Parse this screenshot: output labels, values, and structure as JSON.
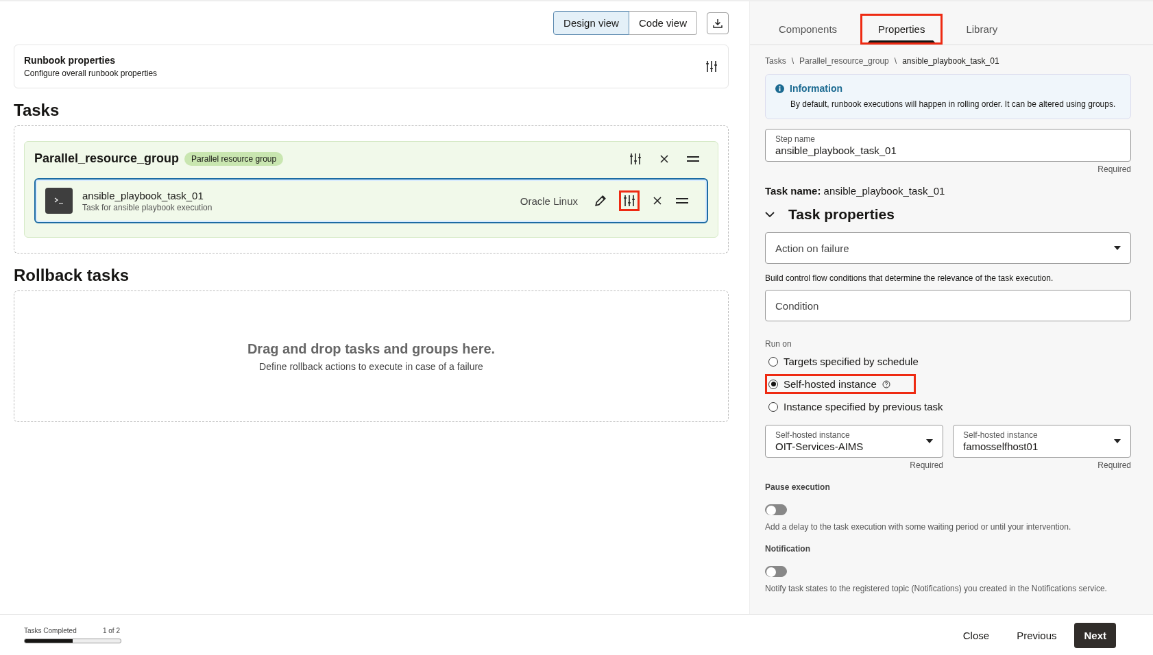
{
  "view_switch": [
    {
      "label": "Design view",
      "selected": true
    },
    {
      "label": "Code view",
      "selected": false
    }
  ],
  "runbook_properties": {
    "title": "Runbook properties",
    "subtitle": "Configure overall runbook properties"
  },
  "tasks_heading": "Tasks",
  "group": {
    "name": "Parallel_resource_group",
    "badge": "Parallel resource group",
    "task": {
      "name": "ansible_playbook_task_01",
      "description": "Task for ansible playbook execution",
      "os": "Oracle Linux",
      "settings_highlighted": true
    }
  },
  "rollback": {
    "heading": "Rollback tasks",
    "title": "Drag and drop tasks and groups here.",
    "subtitle": "Define rollback actions to execute in case of a failure"
  },
  "panel_tabs": [
    {
      "label": "Components",
      "selected": false,
      "highlighted": false
    },
    {
      "label": "Properties",
      "selected": true,
      "highlighted": true
    },
    {
      "label": "Library",
      "selected": false,
      "highlighted": false
    }
  ],
  "breadcrumb": [
    "Tasks",
    "Parallel_resource_group",
    "ansible_playbook_task_01"
  ],
  "breadcrumb_separator": "\\",
  "info": {
    "title": "Information",
    "text": "By default, runbook executions will happen in rolling order. It can be altered using groups."
  },
  "step_name": {
    "label": "Step name",
    "value": "ansible_playbook_task_01",
    "hint": "Required"
  },
  "task_name": {
    "label": "Task name:",
    "value": "ansible_playbook_task_01"
  },
  "task_properties": {
    "heading": "Task properties",
    "expanded": true
  },
  "action_on_failure": {
    "placeholder": "Action on failure"
  },
  "condition": {
    "help": "Build control flow conditions that determine the relevance of the task execution.",
    "placeholder": "Condition"
  },
  "run_on": {
    "label": "Run on",
    "options": [
      {
        "label": "Targets specified by schedule",
        "selected": false,
        "highlighted": false,
        "help_icon": false
      },
      {
        "label": "Self-hosted instance",
        "selected": true,
        "highlighted": true,
        "help_icon": true
      },
      {
        "label": "Instance specified by previous task",
        "selected": false,
        "highlighted": false,
        "help_icon": false
      }
    ]
  },
  "instance_selects": [
    {
      "label": "Self-hosted instance",
      "value": "OIT-Services-AIMS",
      "hint": "Required"
    },
    {
      "label": "Self-hosted instance",
      "value": "famosselfhost01",
      "hint": "Required"
    }
  ],
  "toggles": [
    {
      "label": "Pause execution",
      "on": false,
      "help": "Add a delay to the task execution with some waiting period or until your intervention."
    },
    {
      "label": "Notification",
      "on": false,
      "help": "Notify task states to the registered topic (Notifications) you created in the Notifications service."
    }
  ],
  "footer": {
    "progress_label": "Tasks Completed",
    "progress_count": "1 of 2",
    "level": 0.5,
    "buttons": [
      {
        "label": "Close",
        "kind": "plain"
      },
      {
        "label": "Previous",
        "kind": "plain"
      },
      {
        "label": "Next",
        "kind": "primary"
      }
    ]
  }
}
